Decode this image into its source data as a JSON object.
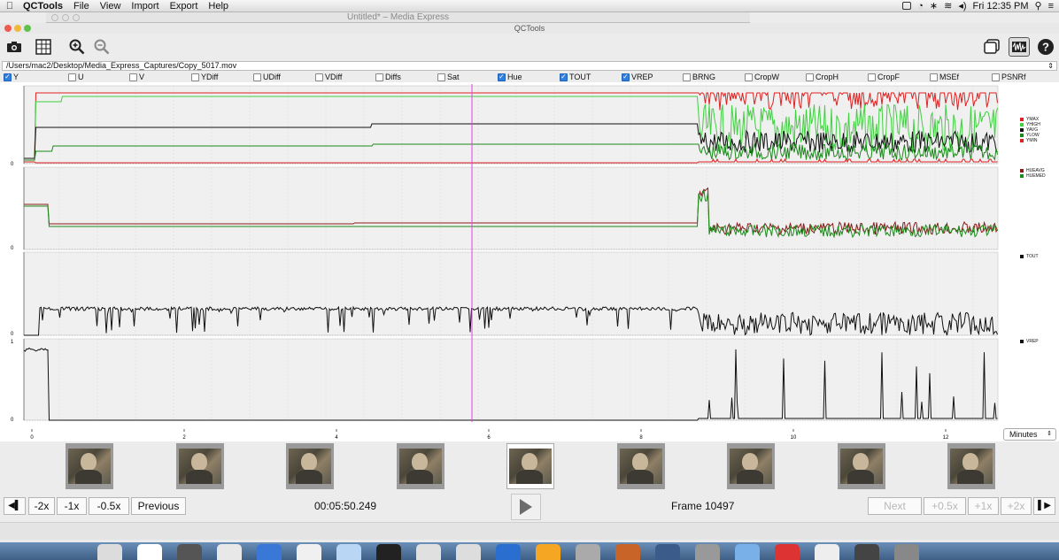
{
  "menubar": {
    "app": "QCTools",
    "items": [
      "File",
      "View",
      "Import",
      "Export",
      "Help"
    ],
    "clock": "Fri 12:35 PM"
  },
  "background_window": {
    "title": "Untitled* – Media Express"
  },
  "window": {
    "title": "QCTools"
  },
  "file_path": "/Users/mac2/Desktop/Media_Express_Captures/Copy_5017.mov",
  "filters": [
    {
      "label": "Y",
      "checked": true
    },
    {
      "label": "U",
      "checked": false
    },
    {
      "label": "V",
      "checked": false
    },
    {
      "label": "YDiff",
      "checked": false
    },
    {
      "label": "UDiff",
      "checked": false
    },
    {
      "label": "VDiff",
      "checked": false
    },
    {
      "label": "Diffs",
      "checked": false
    },
    {
      "label": "Sat",
      "checked": false
    },
    {
      "label": "Hue",
      "checked": true
    },
    {
      "label": "TOUT",
      "checked": true
    },
    {
      "label": "VREP",
      "checked": true
    },
    {
      "label": "BRNG",
      "checked": false
    },
    {
      "label": "CropW",
      "checked": false
    },
    {
      "label": "CropH",
      "checked": false
    },
    {
      "label": "CropF",
      "checked": false
    },
    {
      "label": "MSEf",
      "checked": false
    },
    {
      "label": "PSNRf",
      "checked": false
    }
  ],
  "plots": {
    "y": {
      "zero_label": "0",
      "legend": [
        {
          "name": "YMAX",
          "color": "#e02020"
        },
        {
          "name": "YHIGH",
          "color": "#40d040"
        },
        {
          "name": "YAVG",
          "color": "#111111"
        },
        {
          "name": "YLOW",
          "color": "#1a8a1a"
        },
        {
          "name": "YMIN",
          "color": "#e02020"
        }
      ]
    },
    "hue": {
      "zero_label": "0",
      "legend": [
        {
          "name": "HUEAVG",
          "color": "#8b1a1a"
        },
        {
          "name": "HUEMED",
          "color": "#1a8a1a"
        }
      ]
    },
    "tout": {
      "zero_label": "0",
      "legend": [
        {
          "name": "TOUT",
          "color": "#111111"
        }
      ]
    },
    "vrep": {
      "one_label": "1",
      "zero_label": "0",
      "legend": [
        {
          "name": "VREP",
          "color": "#111111"
        }
      ]
    },
    "cursor_color": "#e040e0"
  },
  "xaxis": {
    "ticks": [
      "0",
      "2",
      "4",
      "6",
      "8",
      "10",
      "12"
    ],
    "units": "Minutes"
  },
  "thumbnails": {
    "count": 9,
    "selected_index": 4
  },
  "transport": {
    "jump_back": "◀▌",
    "speeds_back": [
      "-2x",
      "-1x",
      "-0.5x"
    ],
    "previous": "Previous",
    "timecode": "00:05:50.249",
    "frame": "Frame 10497",
    "next": "Next",
    "speeds_fwd": [
      "+0.5x",
      "+1x",
      "+2x"
    ],
    "jump_fwd": "▌▶"
  }
}
